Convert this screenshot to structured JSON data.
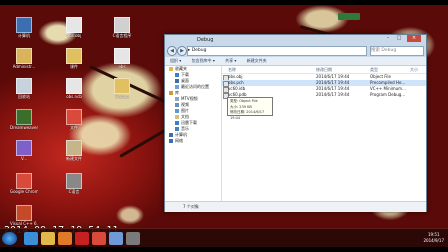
{
  "colors": {
    "accent": "#c94b3e",
    "taskbar": "#2a0c08"
  },
  "desktop_icons": [
    {
      "label": "计算机",
      "color": "#3b6fb0"
    },
    {
      "label": "Administr...",
      "color": "#d9b45a"
    },
    {
      "label": "回收站",
      "color": "#c7d2dc"
    },
    {
      "label": "Dreamweaver",
      "color": "#3a6e2a"
    },
    {
      "label": "V...",
      "color": "#7f5fc8"
    },
    {
      "label": "Google Chrome",
      "color": "#d94a3a"
    },
    {
      "label": "Visual C++ 6.0",
      "color": "#c44a28"
    },
    {
      "label": "Photoshop",
      "color": "#1f4fa0"
    },
    {
      "label": "obs.obj",
      "color": "#e6e6e6"
    },
    {
      "label": "课件",
      "color": "#e0c060"
    },
    {
      "label": "obs.ncb",
      "color": "#e6e6e6"
    },
    {
      "label": "文件",
      "color": "#d94a3a"
    },
    {
      "label": "新建文件",
      "color": "#c6b48a"
    },
    {
      "label": "C语言",
      "color": "#888"
    },
    {
      "label": "C语言程序",
      "color": "#d0d0d0"
    },
    {
      "label": "obs",
      "color": "#e6e6e6"
    },
    {
      "label": "Debug",
      "color": "#e0c060"
    }
  ],
  "window": {
    "title": "Debug",
    "address": "▸ Debug",
    "search_placeholder": "搜索 Debug",
    "toolbar": [
      "组织 ▾",
      "包含到库中 ▾",
      "共享 ▾",
      "新建文件夹"
    ],
    "nav_items": [
      {
        "label": "收藏夹",
        "level": 1,
        "color": "#e2b84a"
      },
      {
        "label": "下载",
        "level": 2,
        "color": "#3a7fd0"
      },
      {
        "label": "桌面",
        "level": 2,
        "color": "#3a6fa8"
      },
      {
        "label": "最近访问的位置",
        "level": 2,
        "color": "#6fa0d8"
      },
      {
        "label": "",
        "level": 1,
        "color": ""
      },
      {
        "label": "库",
        "level": 1,
        "color": "#c89e3c"
      },
      {
        "label": "MTV视频",
        "level": 2,
        "color": "#8ab"
      },
      {
        "label": "视频",
        "level": 2,
        "color": "#6a8fb8"
      },
      {
        "label": "图片",
        "level": 2,
        "color": "#5a9ad0"
      },
      {
        "label": "文档",
        "level": 2,
        "color": "#d0c080"
      },
      {
        "label": "迅雷下载",
        "level": 2,
        "color": "#3a7fd0"
      },
      {
        "label": "音乐",
        "level": 2,
        "color": "#4a80c0"
      },
      {
        "label": "",
        "level": 1,
        "color": ""
      },
      {
        "label": "",
        "level": 1,
        "color": ""
      },
      {
        "label": "计算机",
        "level": 1,
        "color": "#3b6fb0"
      },
      {
        "label": "",
        "level": 1,
        "color": ""
      },
      {
        "label": "网络",
        "level": 1,
        "color": "#3b6fb0"
      }
    ],
    "columns": [
      "名称",
      "修改日期",
      "类型",
      "大小"
    ],
    "files": [
      {
        "name": "obs.obj",
        "date": "2014/6/17 19:44",
        "type": "Object File",
        "size": "",
        "selected": false
      },
      {
        "name": "obs.pch",
        "date": "2014/6/17 19:44",
        "type": "Precompiled He...",
        "size": "",
        "selected": true
      },
      {
        "name": "vc60.idb",
        "date": "2014/6/17 19:44",
        "type": "VC++ Minimum...",
        "size": "",
        "selected": false
      },
      {
        "name": "vc60.pdb",
        "date": "2014/6/17 19:44",
        "type": "Program Debug...",
        "size": "",
        "selected": false
      }
    ],
    "tooltip": [
      "类型: Object File",
      "大小: 239 KB",
      "修改日期: 2014/6/17 19:44"
    ],
    "status": "7 个对象"
  },
  "timestamp": "2014-09-17 19:54:11",
  "clock": {
    "time": "19:51",
    "date": "2014/9/17"
  },
  "taskbar_icons": [
    {
      "name": "ie-icon",
      "color": "#3a8fd8"
    },
    {
      "name": "folder-icon",
      "color": "#e2b84a"
    },
    {
      "name": "media-player-icon",
      "color": "#e07a28"
    },
    {
      "name": "app-icon",
      "color": "#c62020"
    },
    {
      "name": "chrome-icon",
      "color": "#d94a3a"
    },
    {
      "name": "explorer-icon",
      "color": "#6f9ad8"
    },
    {
      "name": "recorder-icon",
      "color": "#7a7a7a"
    }
  ]
}
